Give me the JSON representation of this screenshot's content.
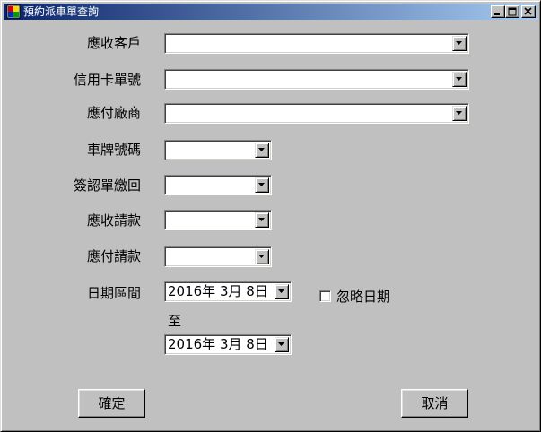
{
  "window": {
    "title": "預約派車單查詢",
    "icon": "app-icon"
  },
  "form": {
    "customer_receivable": {
      "label": "應收客戶",
      "value": ""
    },
    "credit_card_no": {
      "label": "信用卡單號",
      "value": ""
    },
    "vendor_payable": {
      "label": "應付廠商",
      "value": ""
    },
    "plate_no": {
      "label": "車牌號碼",
      "value": ""
    },
    "sign_return": {
      "label": "簽認單繳回",
      "value": ""
    },
    "receivable_request": {
      "label": "應收請款",
      "value": ""
    },
    "payable_request": {
      "label": "應付請款",
      "value": ""
    },
    "date_range": {
      "label": "日期區間",
      "from": "2016年 3月 8日",
      "to_label": "至",
      "to": "2016年 3月 8日"
    },
    "ignore_date": {
      "label": "忽略日期",
      "checked": false
    }
  },
  "buttons": {
    "ok": "確定",
    "cancel": "取消"
  }
}
